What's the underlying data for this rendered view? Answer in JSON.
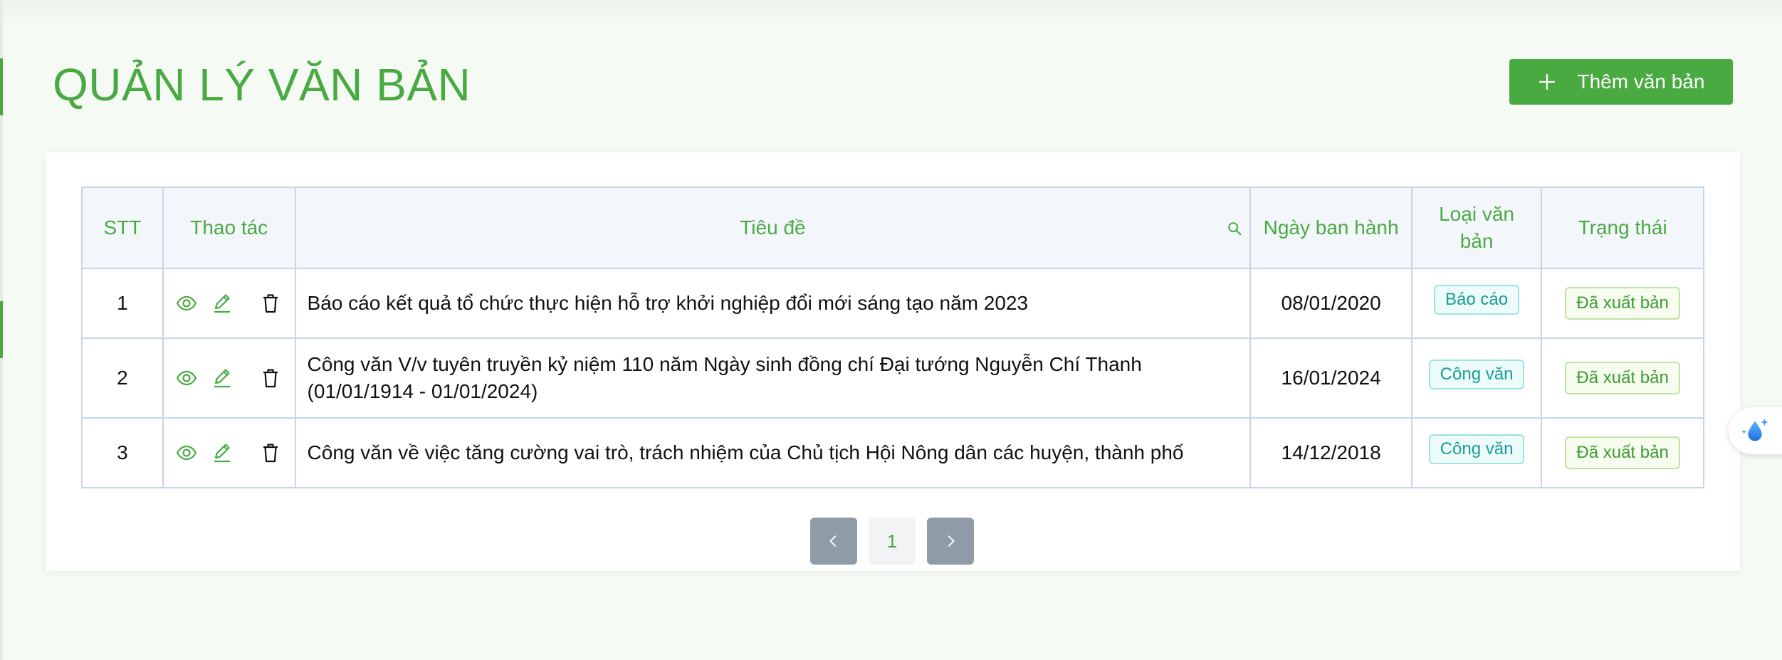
{
  "page": {
    "title": "QUẢN LÝ VĂN BẢN"
  },
  "toolbar": {
    "add_label": "Thêm văn bản",
    "add_icon": "plus-icon"
  },
  "table": {
    "columns": [
      {
        "key": "stt",
        "label": "STT"
      },
      {
        "key": "actions",
        "label": "Thao tác"
      },
      {
        "key": "title",
        "label": "Tiêu đề",
        "icon": "search-icon"
      },
      {
        "key": "date",
        "label": "Ngày ban hành"
      },
      {
        "key": "type",
        "label": "Loại văn bản"
      },
      {
        "key": "status",
        "label": "Trạng thái"
      }
    ],
    "action_icons": [
      "view-icon",
      "edit-icon",
      "delete-icon"
    ],
    "rows": [
      {
        "stt": "1",
        "title": "Báo cáo kết quả tổ chức thực hiện hỗ trợ khởi nghiệp đổi mới sáng tạo năm 2023",
        "date": "08/01/2020",
        "type": "Báo cáo",
        "status": "Đã xuất bản"
      },
      {
        "stt": "2",
        "title_line1": "Công văn V/v tuyên truyền kỷ niệm 110 năm Ngày sinh đồng chí Đại tướng Nguyễn Chí Thanh",
        "title_line2": "(01/01/1914 - 01/01/2024)",
        "date": "16/01/2024",
        "type": "Công văn",
        "status": "Đã xuất bản"
      },
      {
        "stt": "3",
        "title": "Công văn về việc tăng cường vai trò, trách nhiệm của Chủ tịch Hội Nông dân các huyện, thành phố",
        "date": "14/12/2018",
        "type": "Công văn",
        "status": "Đã xuất bản"
      }
    ]
  },
  "pagination": {
    "current_page": "1"
  },
  "colors": {
    "brand": "#4aaa42",
    "header_bg": "#f3f6fb",
    "type_badge": "#199d95",
    "status_badge": "#3f9a34",
    "pager_button": "#8f9ba7"
  }
}
